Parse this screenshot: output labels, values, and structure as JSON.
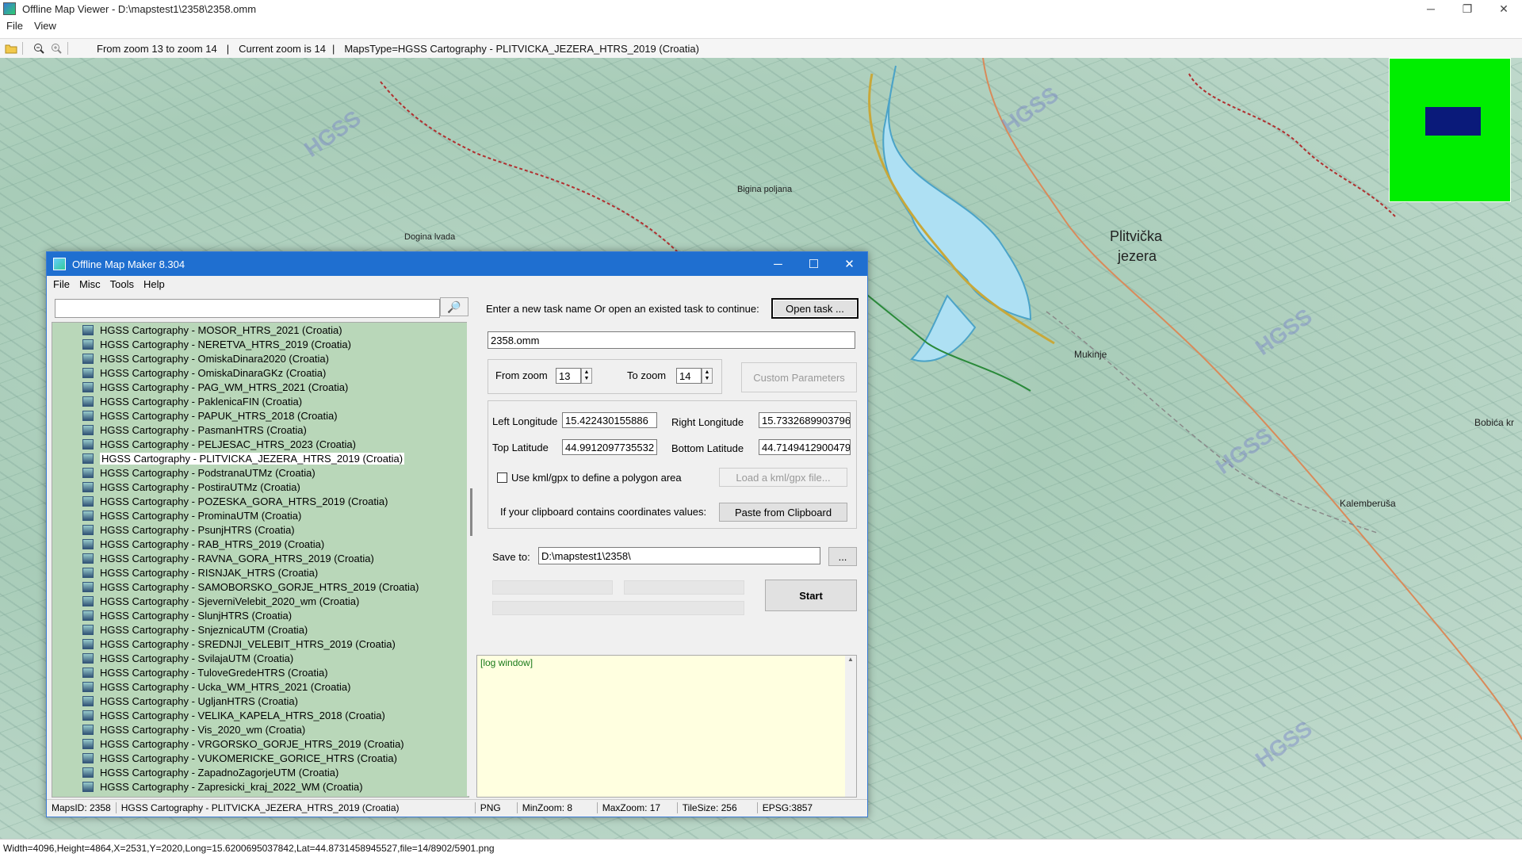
{
  "window": {
    "title": "Offline Map Viewer - D:\\mapstest1\\2358\\2358.omm",
    "minimize": "─",
    "maximize": "❐",
    "close": "✕"
  },
  "menu": {
    "file": "File",
    "view": "View"
  },
  "toolbar": {
    "zoom_range": "From zoom 13 to zoom 14",
    "sep1": "|",
    "current_zoom": "Current zoom is 14",
    "sep2": "|",
    "maps_type": "MapsType=HGSS Cartography - PLITVICKA_JEZERA_HTRS_2019 (Croatia)"
  },
  "map": {
    "labels": [
      "Plitvička",
      "jezera",
      "Mukinje",
      "Kalemberuša",
      "HGSS",
      "Bobića kr",
      "Dogina lvada",
      "Bigina poljana"
    ]
  },
  "status": "Width=4096,Height=4864,X=2531,Y=2020,Long=15.6200695037842,Lat=44.8731458945527,file=14/8902/5901.png",
  "dialog": {
    "title": "Offline Map Maker 8.304",
    "menu": {
      "file": "File",
      "misc": "Misc",
      "tools": "Tools",
      "help": "Help"
    },
    "search_placeholder": "",
    "search_icon": "🔎",
    "maps": [
      "HGSS Cartography - MOSOR_HTRS_2021 (Croatia)",
      "HGSS Cartography - NERETVA_HTRS_2019 (Croatia)",
      "HGSS Cartography - OmiskaDinara2020 (Croatia)",
      "HGSS Cartography - OmiskaDinaraGKz (Croatia)",
      "HGSS Cartography - PAG_WM_HTRS_2021 (Croatia)",
      "HGSS Cartography - PaklenicaFIN (Croatia)",
      "HGSS Cartography - PAPUK_HTRS_2018 (Croatia)",
      "HGSS Cartography - PasmanHTRS (Croatia)",
      "HGSS Cartography - PELJESAC_HTRS_2023 (Croatia)",
      "HGSS Cartography - PLITVICKA_JEZERA_HTRS_2019 (Croatia)",
      "HGSS Cartography - PodstranaUTMz (Croatia)",
      "HGSS Cartography - PostiraUTMz (Croatia)",
      "HGSS Cartography - POZESKA_GORA_HTRS_2019 (Croatia)",
      "HGSS Cartography - ProminaUTM (Croatia)",
      "HGSS Cartography - PsunjHTRS (Croatia)",
      "HGSS Cartography - RAB_HTRS_2019 (Croatia)",
      "HGSS Cartography - RAVNA_GORA_HTRS_2019 (Croatia)",
      "HGSS Cartography - RISNJAK_HTRS (Croatia)",
      "HGSS Cartography - SAMOBORSKO_GORJE_HTRS_2019 (Croatia)",
      "HGSS Cartography - SjeverniVelebit_2020_wm (Croatia)",
      "HGSS Cartography - SlunjHTRS (Croatia)",
      "HGSS Cartography - SnjeznicaUTM (Croatia)",
      "HGSS Cartography - SREDNJI_VELEBIT_HTRS_2019 (Croatia)",
      "HGSS Cartography - SvilajaUTM (Croatia)",
      "HGSS Cartography - TuloveGredeHTRS (Croatia)",
      "HGSS Cartography - Ucka_WM_HTRS_2021 (Croatia)",
      "HGSS Cartography - UgljanHTRS (Croatia)",
      "HGSS Cartography - VELIKA_KAPELA_HTRS_2018 (Croatia)",
      "HGSS Cartography - Vis_2020_wm (Croatia)",
      "HGSS Cartography - VRGORSKO_GORJE_HTRS_2019 (Croatia)",
      "HGSS Cartography - VUKOMERICKE_GORICE_HTRS (Croatia)",
      "HGSS Cartography - ZapadnoZagorjeUTM (Croatia)",
      "HGSS Cartography - Zapresicki_kraj_2022_WM (Croatia)"
    ],
    "selected_map_index": 9,
    "task_prompt": "Enter a new task name Or open an existed task to continue:",
    "open_task": "Open task ...",
    "task_name": "2358.omm",
    "from_zoom_label": "From zoom",
    "from_zoom": "13",
    "to_zoom_label": "To zoom",
    "to_zoom": "14",
    "custom_params": "Custom Parameters",
    "left_lon_label": "Left Longitude",
    "left_lon": "15.422430155886",
    "right_lon_label": "Right Longitude",
    "right_lon": "15.7332689903796",
    "top_lat_label": "Top Latitude",
    "top_lat": "44.9912097735532",
    "bottom_lat_label": "Bottom Latitude",
    "bottom_lat": "44.7149412900479",
    "kml_label": "Use kml/gpx to define a polygon area",
    "load_kml": "Load a kml/gpx file...",
    "clipboard_label": "If your clipboard contains coordinates values:",
    "paste_clipboard": "Paste from Clipboard",
    "save_to_label": "Save to:",
    "save_to": "D:\\mapstest1\\2358\\",
    "browse": "...",
    "start": "Start",
    "log": "[log window]",
    "status": {
      "maps_id": "MapsID: 2358",
      "name": "HGSS Cartography - PLITVICKA_JEZERA_HTRS_2019 (Croatia)",
      "format": "PNG",
      "min_zoom": "MinZoom: 8",
      "max_zoom": "MaxZoom: 17",
      "tile_size": "TileSize: 256",
      "epsg": "EPSG:3857"
    }
  }
}
